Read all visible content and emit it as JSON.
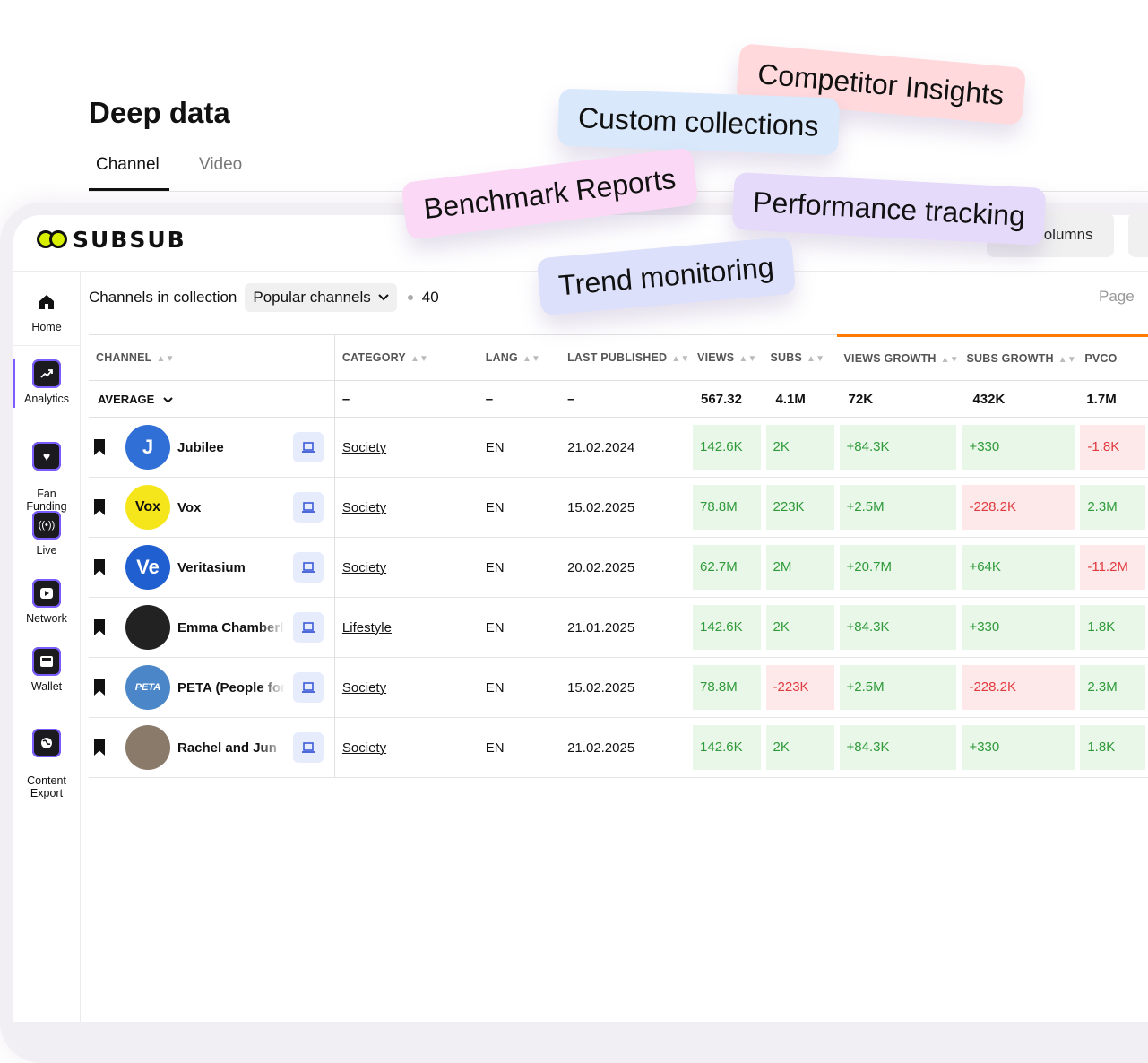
{
  "brand": {
    "name": "SUBSUB"
  },
  "sidebar": {
    "items": [
      {
        "label": "Home",
        "icon": "home-icon"
      },
      {
        "label": "Analytics",
        "icon": "trending-up-icon"
      },
      {
        "label": "Fan\nFunding",
        "icon": "heart-icon"
      },
      {
        "label": "Live",
        "icon": "broadcast-icon"
      },
      {
        "label": "Network",
        "icon": "play-icon"
      },
      {
        "label": "Wallet",
        "icon": "wallet-icon"
      },
      {
        "label": "Content\nExport",
        "icon": "globe-icon"
      }
    ]
  },
  "page": {
    "title": "Deep data",
    "tabs": [
      {
        "label": "Channel"
      },
      {
        "label": "Video"
      }
    ],
    "columns_button": "Columns",
    "filter": {
      "label": "Channels in collection",
      "selected": "Popular channels",
      "count": "40"
    },
    "pagination_label": "Page"
  },
  "table": {
    "headers": [
      "CHANNEL",
      "CATEGORY",
      "LANG",
      "LAST PUBLISHED",
      "VIEWS",
      "SUBS",
      "VIEWS GROWTH",
      "SUBS GROWTH",
      "PVCO"
    ],
    "average": {
      "label": "AVERAGE",
      "category": "–",
      "lang": "–",
      "last_published": "–",
      "views": "567.32",
      "subs": "4.1M",
      "views_growth": "72K",
      "subs_growth": "432K",
      "pvco": "1.7M"
    },
    "rows": [
      {
        "channel": "Jubilee",
        "category": "Society",
        "lang": "EN",
        "last_published": "21.02.2024",
        "views": "142.6K",
        "subs": "2K",
        "views_growth": "+84.3K",
        "subs_growth": "+330",
        "pvco": "-1.8K"
      },
      {
        "channel": "Vox",
        "category": "Society",
        "lang": "EN",
        "last_published": "15.02.2025",
        "views": "78.8M",
        "subs": "223K",
        "views_growth": "+2.5M",
        "subs_growth": "-228.2K",
        "pvco": "2.3M"
      },
      {
        "channel": "Veritasium",
        "category": "Society",
        "lang": "EN",
        "last_published": "20.02.2025",
        "views": "62.7M",
        "subs": "2M",
        "views_growth": "+20.7M",
        "subs_growth": "+64K",
        "pvco": "-11.2M"
      },
      {
        "channel": "Emma Chamberlain",
        "category": "Lifestyle",
        "lang": "EN",
        "last_published": "21.01.2025",
        "views": "142.6K",
        "subs": "2K",
        "views_growth": "+84.3K",
        "subs_growth": "+330",
        "pvco": "1.8K"
      },
      {
        "channel": "PETA (People for",
        "category": "Society",
        "lang": "EN",
        "last_published": "15.02.2025",
        "views": "78.8M",
        "subs": "-223K",
        "views_growth": "+2.5M",
        "subs_growth": "-228.2K",
        "pvco": "2.3M"
      },
      {
        "channel": "Rachel and Jun",
        "category": "Society",
        "lang": "EN",
        "last_published": "21.02.2025",
        "views": "142.6K",
        "subs": "2K",
        "views_growth": "+84.3K",
        "subs_growth": "+330",
        "pvco": "1.8K"
      }
    ],
    "avatars": [
      {
        "text": "J",
        "color": "#2f6fd6"
      },
      {
        "text": "Vox",
        "color": "#f5e61c"
      },
      {
        "text": "Ve",
        "color": "#1f5fd0"
      },
      {
        "text": "",
        "color": "#222222"
      },
      {
        "text": "PETA",
        "color": "#4a86c8"
      },
      {
        "text": "",
        "color": "#8a7a6a"
      }
    ]
  },
  "tags": [
    {
      "label": "Competitor Insights",
      "color": "#ffd9dc"
    },
    {
      "label": "Custom collections",
      "color": "#d9e8fb"
    },
    {
      "label": "Benchmark Reports",
      "color": "#fbd8f5"
    },
    {
      "label": "Performance tracking",
      "color": "#e5dafa"
    },
    {
      "label": "Trend monitoring",
      "color": "#dde0fa"
    }
  ],
  "colors": {
    "accent": "#7a5cff",
    "highlight": "#ff7a00",
    "positive_bg": "#e9f7e8",
    "negative_bg": "#fde9e9"
  }
}
